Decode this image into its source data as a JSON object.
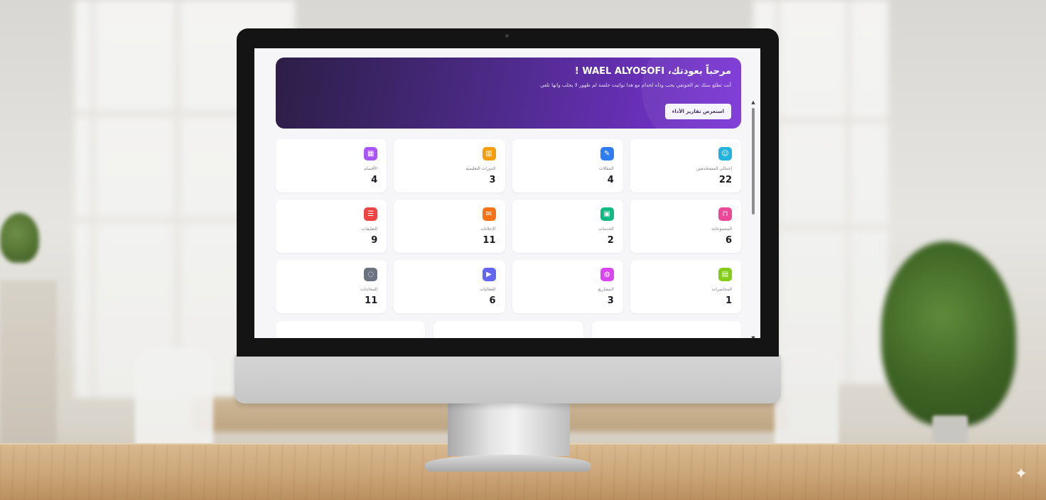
{
  "banner": {
    "title": "مرحباً بعودتك، WAEL ALYOSOFI !",
    "description": "أنت تطلع ستك نم الحوتفي يحب وذاه لخدام مع هدا نواتيت جلسة لم ظهور لا يجلب وانها تلقي",
    "button_label": "استعرض تقارير الأداء"
  },
  "stats": [
    {
      "label": "إجمالي المستخدمين",
      "value": "22",
      "icon": "user-icon",
      "color": "#22b3e0"
    },
    {
      "label": "المقالات",
      "value": "4",
      "icon": "article-icon",
      "color": "#2f7df3"
    },
    {
      "label": "الدورات التعليمية",
      "value": "3",
      "icon": "book-icon",
      "color": "#f59e0b"
    },
    {
      "label": "الأقسام",
      "value": "4",
      "icon": "grid-icon",
      "color": "#a855f7"
    },
    {
      "label": "المجموعات",
      "value": "6",
      "icon": "bag-icon",
      "color": "#ec4899"
    },
    {
      "label": "الخدمات",
      "value": "2",
      "icon": "calendar-icon",
      "color": "#10b981"
    },
    {
      "label": "الإعلانات",
      "value": "11",
      "icon": "megaphone-icon",
      "color": "#f97316"
    },
    {
      "label": "التعليقات",
      "value": "9",
      "icon": "clipboard-icon",
      "color": "#ef4444"
    },
    {
      "label": "المحاضرات",
      "value": "1",
      "icon": "briefcase-icon",
      "color": "#84cc16"
    },
    {
      "label": "المشاريع",
      "value": "3",
      "icon": "globe-icon",
      "color": "#d946ef"
    },
    {
      "label": "الفعاليات",
      "value": "6",
      "icon": "play-icon",
      "color": "#6366f1"
    },
    {
      "label": "المحادثات",
      "value": "11",
      "icon": "chat-icon",
      "color": "#6b7280"
    }
  ]
}
